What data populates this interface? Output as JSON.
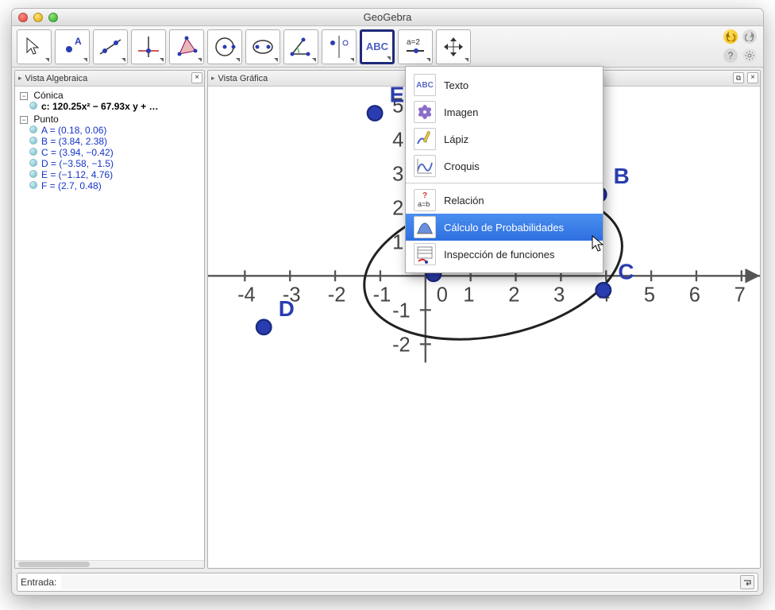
{
  "window": {
    "title": "GeoGebra"
  },
  "toolbar": {
    "tools": [
      {
        "name": "cursor",
        "label": "Mover"
      },
      {
        "name": "point",
        "label": "Punto"
      },
      {
        "name": "line",
        "label": "Recta"
      },
      {
        "name": "perpendicular",
        "label": "Perpendicular"
      },
      {
        "name": "polygon",
        "label": "Polígono"
      },
      {
        "name": "circle",
        "label": "Circunferencia"
      },
      {
        "name": "ellipse",
        "label": "Elipse"
      },
      {
        "name": "angle",
        "label": "Ángulo"
      },
      {
        "name": "reflect",
        "label": "Simetría"
      },
      {
        "name": "text",
        "label": "ABC",
        "selected": true
      },
      {
        "name": "slider",
        "label": "a=2"
      },
      {
        "name": "move-view",
        "label": "Mover Vista"
      }
    ],
    "undo": "Deshacer",
    "redo": "Rehacer",
    "help": "Ayuda",
    "settings": "Ajustes"
  },
  "panels": {
    "algebra": {
      "title": "Vista Algebraica",
      "close": "×"
    },
    "graphics": {
      "title": "Vista Gráfica",
      "close": "×",
      "detach": "⧉"
    }
  },
  "algebra": {
    "groups": [
      {
        "name": "Cónica",
        "items": [
          {
            "formula": "c: 120.25x² − 67.93x y + …"
          }
        ]
      },
      {
        "name": "Punto",
        "items": [
          {
            "formula": "A = (0.18, 0.06)"
          },
          {
            "formula": "B = (3.84, 2.38)"
          },
          {
            "formula": "C = (3.94, −0.42)"
          },
          {
            "formula": "D = (−3.58, −1.5)"
          },
          {
            "formula": "E = (−1.12, 4.76)"
          },
          {
            "formula": "F = (2.7, 0.48)"
          }
        ]
      }
    ]
  },
  "dropdown": {
    "items": [
      {
        "icon": "text",
        "label": "Texto"
      },
      {
        "icon": "image",
        "label": "Imagen"
      },
      {
        "icon": "pencil",
        "label": "Lápiz"
      },
      {
        "icon": "sketch",
        "label": "Croquis"
      }
    ],
    "items2": [
      {
        "icon": "relation",
        "label": "Relación"
      },
      {
        "icon": "probability",
        "label": "Cálculo de Probabilidades",
        "highlight": true
      },
      {
        "icon": "inspect",
        "label": "Inspección de funciones"
      }
    ]
  },
  "chart_data": {
    "type": "scatter",
    "title": "",
    "xlabel": "",
    "ylabel": "",
    "xlim": [
      -4,
      7
    ],
    "ylim": [
      -2,
      5
    ],
    "xticks": [
      -4,
      -3,
      -2,
      -1,
      0,
      1,
      2,
      3,
      4,
      5,
      6,
      7
    ],
    "yticks": [
      -2,
      -1,
      0,
      1,
      2,
      3,
      4,
      5
    ],
    "series": [
      {
        "name": "Puntos",
        "points": [
          {
            "label": "A",
            "x": 0.18,
            "y": 0.06
          },
          {
            "label": "B",
            "x": 3.84,
            "y": 2.38
          },
          {
            "label": "C",
            "x": 3.94,
            "y": -0.42
          },
          {
            "label": "D",
            "x": -3.58,
            "y": -1.5
          },
          {
            "label": "E",
            "x": -1.12,
            "y": 4.76
          },
          {
            "label": "F",
            "x": 2.7,
            "y": 0.48
          }
        ]
      }
    ],
    "conic": {
      "name": "c",
      "cx": 1.5,
      "cy": 0.3,
      "rx": 2.9,
      "ry": 2.05,
      "rotation_deg": -12
    }
  },
  "inputbar": {
    "label": "Entrada:",
    "value": "",
    "submit": "↵"
  }
}
